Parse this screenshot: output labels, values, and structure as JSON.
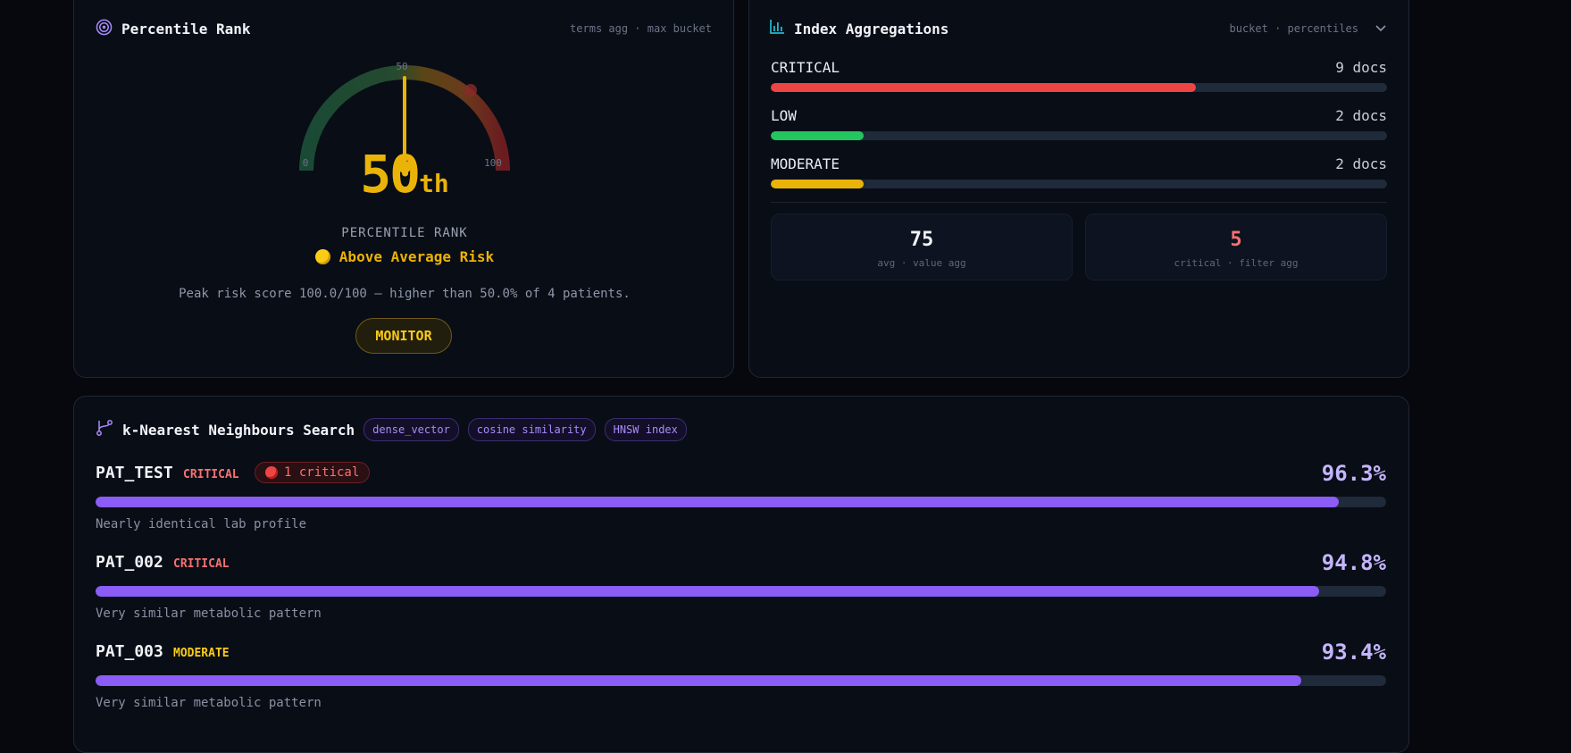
{
  "percentile": {
    "title": "Percentile Rank",
    "meta": "terms agg · max bucket",
    "gauge_min_label": "0",
    "gauge_mid_label": "50",
    "gauge_max_label": "100",
    "gauge_value": 50,
    "rank_number": "50",
    "rank_suffix": "th",
    "rank_label": "PERCENTILE RANK",
    "risk_label": "Above Average Risk",
    "summary": "Peak risk score 100.0/100 — higher than 50.0% of 4 patients.",
    "action_label": "MONITOR",
    "colors": {
      "accent": "#eab308",
      "low": "#22c55e",
      "high": "#ef4444"
    }
  },
  "aggregations": {
    "title": "Index Aggregations",
    "meta": "bucket · percentiles",
    "buckets": [
      {
        "label": "CRITICAL",
        "count": "9 docs",
        "fraction": 0.69,
        "color": "#ef4444"
      },
      {
        "label": "LOW",
        "count": "2 docs",
        "fraction": 0.15,
        "color": "#22c55e"
      },
      {
        "label": "MODERATE",
        "count": "2 docs",
        "fraction": 0.15,
        "color": "#eab308"
      }
    ],
    "stats": [
      {
        "value": "75",
        "caption": "avg · value agg",
        "color": "#f1f3f8"
      },
      {
        "value": "5",
        "caption": "critical · filter agg",
        "color": "#f87171"
      }
    ]
  },
  "knn": {
    "title": "k-Nearest Neighbours Search",
    "tags": [
      "dense_vector",
      "cosine similarity",
      "HNSW index"
    ],
    "neighbours": [
      {
        "id": "PAT_TEST",
        "severity": "CRITICAL",
        "severity_color": "#f87171",
        "badge": "1 critical",
        "score": "96.3%",
        "similarity": 0.963,
        "description": "Nearly identical lab profile"
      },
      {
        "id": "PAT_002",
        "severity": "CRITICAL",
        "severity_color": "#f87171",
        "badge": "",
        "score": "94.8%",
        "similarity": 0.948,
        "description": "Very similar metabolic pattern"
      },
      {
        "id": "PAT_003",
        "severity": "MODERATE",
        "severity_color": "#facc15",
        "badge": "",
        "score": "93.4%",
        "similarity": 0.934,
        "description": "Very similar metabolic pattern"
      }
    ]
  }
}
